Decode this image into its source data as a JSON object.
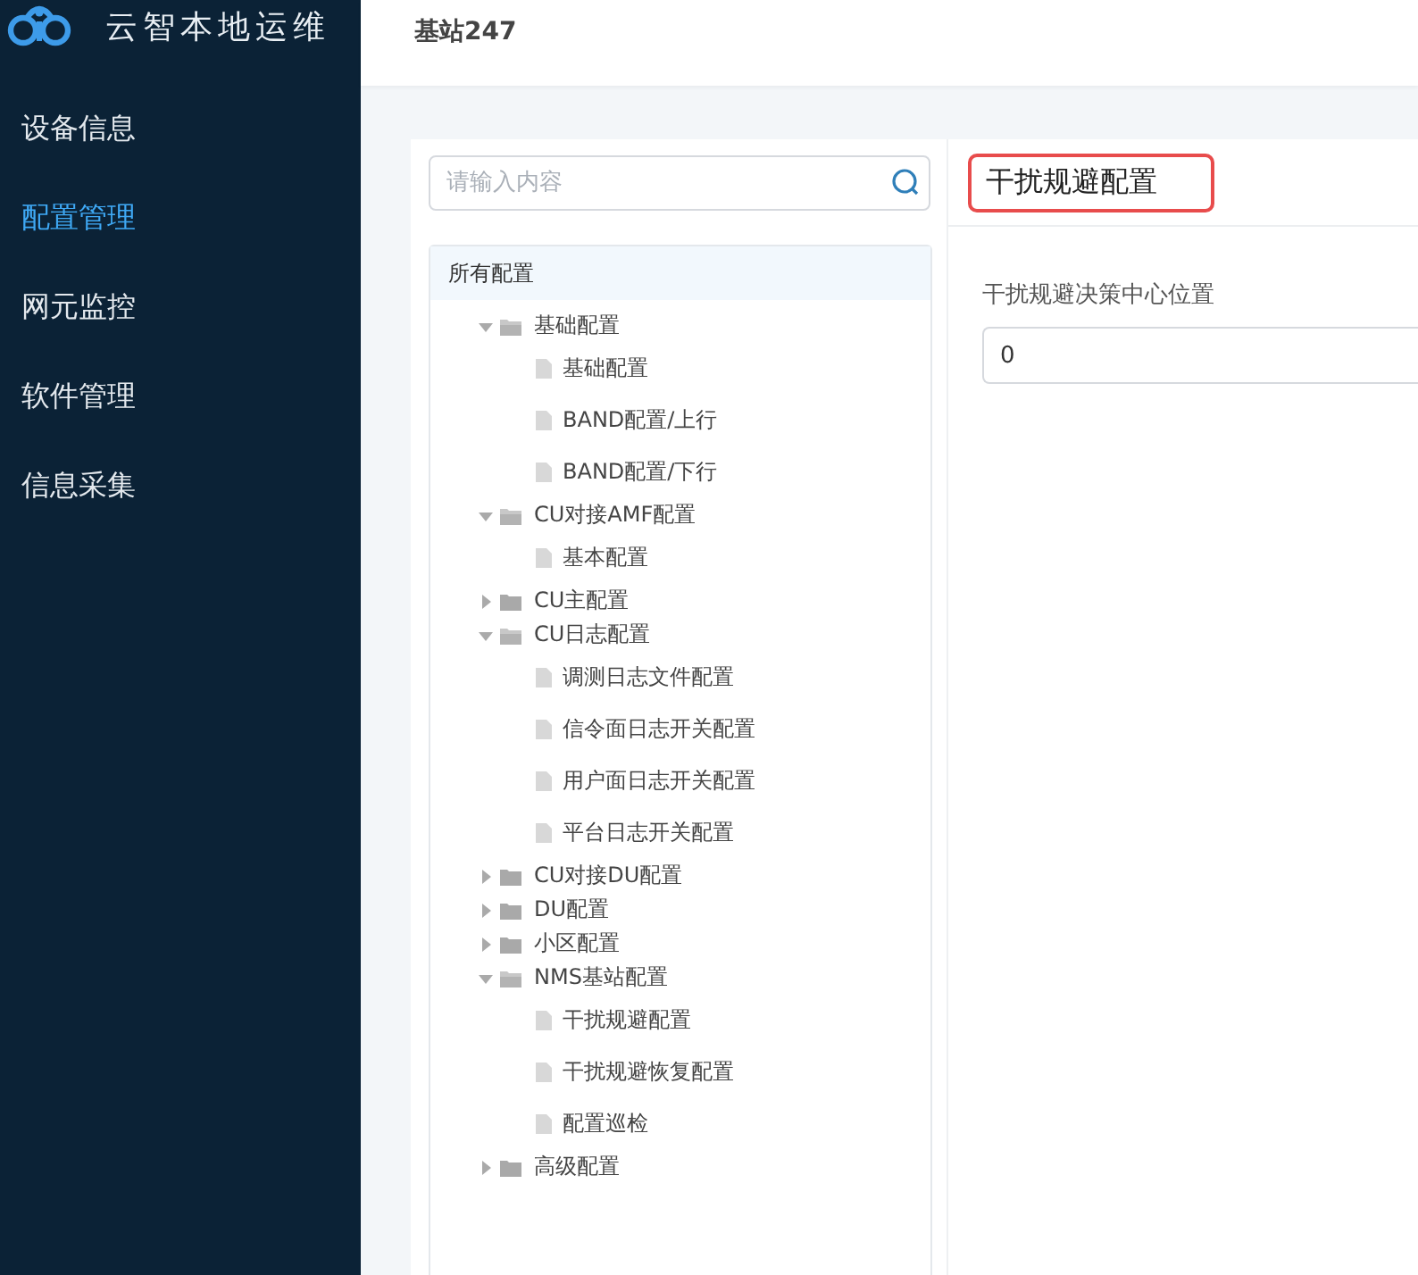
{
  "app": {
    "title": "云智本地运维"
  },
  "sidebar": {
    "items": [
      {
        "label": "设备信息",
        "selected": false
      },
      {
        "label": "配置管理",
        "selected": true
      },
      {
        "label": "网元监控",
        "selected": false
      },
      {
        "label": "软件管理",
        "selected": false
      },
      {
        "label": "信息采集",
        "selected": false
      }
    ]
  },
  "header": {
    "title": "基站247"
  },
  "config_tree": {
    "search": {
      "placeholder": "请输入内容"
    },
    "root": "所有配置",
    "nodes": [
      {
        "kind": "folder",
        "label": "基础配置",
        "expanded": true,
        "children": [
          {
            "kind": "file",
            "label": "基础配置"
          },
          {
            "kind": "file",
            "label": "BAND配置/上行"
          },
          {
            "kind": "file",
            "label": "BAND配置/下行"
          }
        ]
      },
      {
        "kind": "folder",
        "label": "CU对接AMF配置",
        "expanded": true,
        "children": [
          {
            "kind": "file",
            "label": "基本配置"
          }
        ]
      },
      {
        "kind": "folder",
        "label": "CU主配置",
        "expanded": false
      },
      {
        "kind": "folder",
        "label": "CU日志配置",
        "expanded": true,
        "children": [
          {
            "kind": "file",
            "label": "调测日志文件配置"
          },
          {
            "kind": "file",
            "label": "信令面日志开关配置"
          },
          {
            "kind": "file",
            "label": "用户面日志开关配置"
          },
          {
            "kind": "file",
            "label": "平台日志开关配置"
          }
        ]
      },
      {
        "kind": "folder",
        "label": "CU对接DU配置",
        "expanded": false
      },
      {
        "kind": "folder",
        "label": "DU配置",
        "expanded": false
      },
      {
        "kind": "folder",
        "label": "小区配置",
        "expanded": false
      },
      {
        "kind": "folder",
        "label": "NMS基站配置",
        "expanded": true,
        "children": [
          {
            "kind": "file",
            "label": "干扰规避配置"
          },
          {
            "kind": "file",
            "label": "干扰规避恢复配置"
          },
          {
            "kind": "file",
            "label": "配置巡检"
          }
        ]
      },
      {
        "kind": "folder",
        "label": "高级配置",
        "expanded": false
      }
    ]
  },
  "detail": {
    "title": {
      "text": "干扰规避配置",
      "highlighted": true
    },
    "fields": [
      {
        "label": "干扰规避决策中心位置",
        "value": "0"
      }
    ]
  }
}
